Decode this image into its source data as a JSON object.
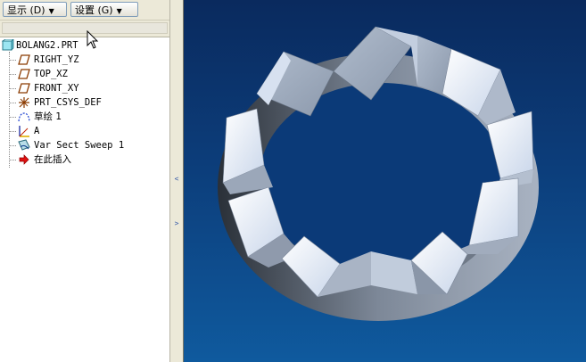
{
  "toolbar": {
    "show_label": "显示 (D)",
    "settings_label": "设置 (G)"
  },
  "tree": {
    "root": "BOLANG2.PRT",
    "items": [
      {
        "label": "RIGHT_YZ",
        "icon": "datum-plane-icon"
      },
      {
        "label": "TOP_XZ",
        "icon": "datum-plane-icon"
      },
      {
        "label": "FRONT_XY",
        "icon": "datum-plane-icon"
      },
      {
        "label": "PRT_CSYS_DEF",
        "icon": "coordinate-system-icon"
      },
      {
        "label": "草绘 1",
        "icon": "sketch-icon"
      },
      {
        "label": "A",
        "icon": "datum-axis-icon"
      },
      {
        "label": "Var Sect Sweep 1",
        "icon": "sweep-feature-icon"
      },
      {
        "label": "在此插入",
        "icon": "insert-here-arrow-icon"
      }
    ]
  },
  "colors": {
    "viewport_top": "#0a2a5e",
    "viewport_bottom": "#0f5a9e",
    "model_light": "#e6eefc",
    "model_mid": "#9aa6b8",
    "model_dark": "#3c4450"
  }
}
